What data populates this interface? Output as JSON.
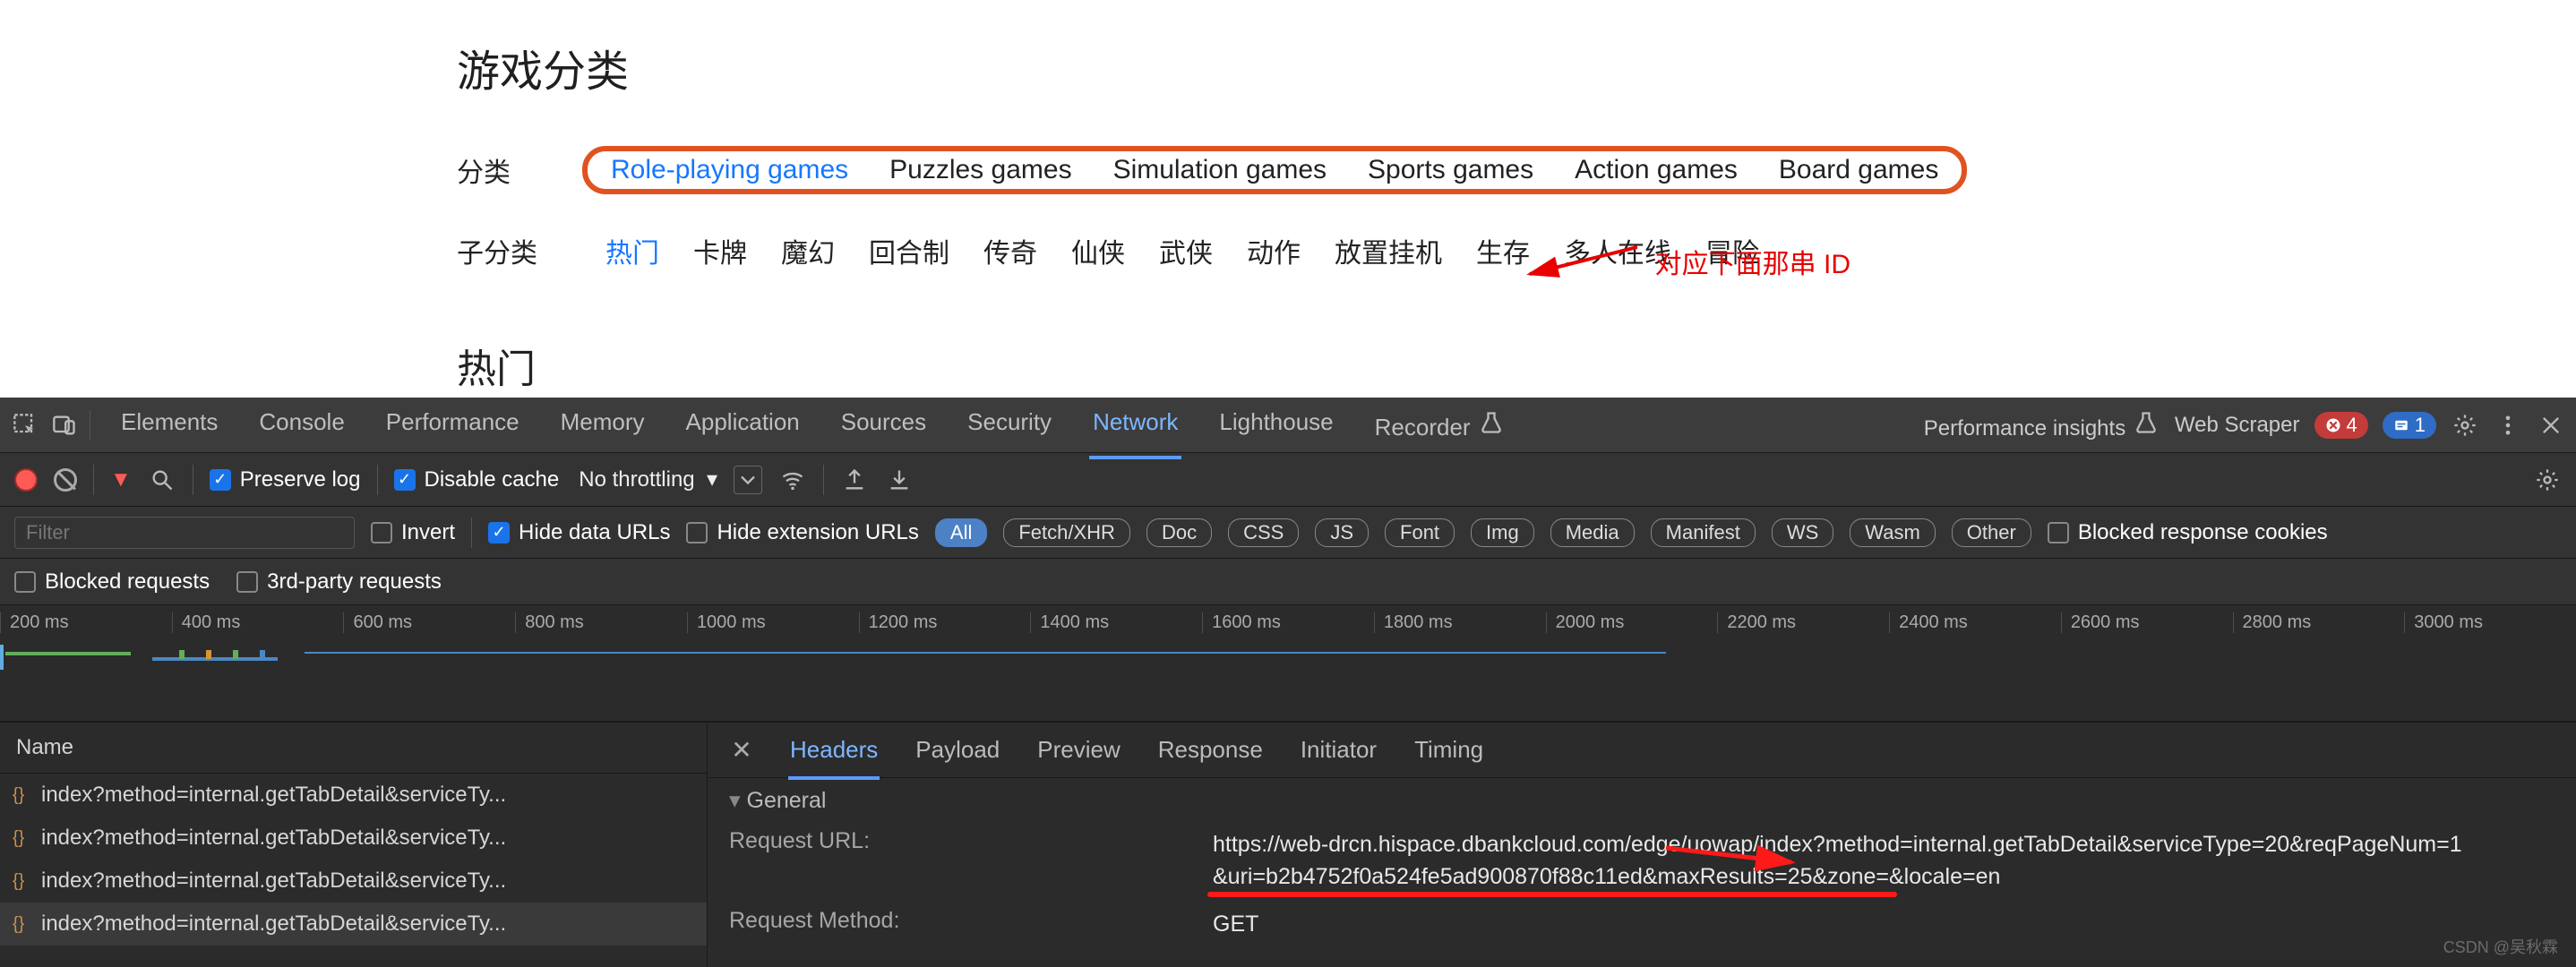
{
  "page": {
    "title": "游戏分类",
    "category_label": "分类",
    "subcategory_label": "子分类",
    "categories": [
      "Role-playing games",
      "Puzzles games",
      "Simulation games",
      "Sports games",
      "Action games",
      "Board games"
    ],
    "subcategories": [
      "热门",
      "卡牌",
      "魔幻",
      "回合制",
      "传奇",
      "仙侠",
      "武侠",
      "动作",
      "放置挂机",
      "生存",
      "多人在线",
      "冒险"
    ],
    "section_title": "热门",
    "annotation_text": "对应下面那串 ID"
  },
  "devtools": {
    "tabs": [
      "Elements",
      "Console",
      "Performance",
      "Memory",
      "Application",
      "Sources",
      "Security",
      "Network",
      "Lighthouse",
      "Recorder"
    ],
    "active_tab": "Network",
    "right_tabs": [
      "Performance insights",
      "Web Scraper"
    ],
    "error_count": "4",
    "info_count": "1",
    "subbar": {
      "preserve_log": "Preserve log",
      "disable_cache": "Disable cache",
      "throttling": "No throttling"
    },
    "filterbar": {
      "filter_placeholder": "Filter",
      "invert": "Invert",
      "hide_data_urls": "Hide data URLs",
      "hide_ext_urls": "Hide extension URLs",
      "types": [
        "All",
        "Fetch/XHR",
        "Doc",
        "CSS",
        "JS",
        "Font",
        "Img",
        "Media",
        "Manifest",
        "WS",
        "Wasm",
        "Other"
      ],
      "blocked_cookies": "Blocked response cookies",
      "blocked_requests": "Blocked requests",
      "third_party": "3rd-party requests"
    },
    "timeline_ticks": [
      "200 ms",
      "400 ms",
      "600 ms",
      "800 ms",
      "1000 ms",
      "1200 ms",
      "1400 ms",
      "1600 ms",
      "1800 ms",
      "2000 ms",
      "2200 ms",
      "2400 ms",
      "2600 ms",
      "2800 ms",
      "3000 ms"
    ],
    "reqlist_header": "Name",
    "requests": [
      "index?method=internal.getTabDetail&serviceTy...",
      "index?method=internal.getTabDetail&serviceTy...",
      "index?method=internal.getTabDetail&serviceTy...",
      "index?method=internal.getTabDetail&serviceTy..."
    ],
    "detail_tabs": [
      "Headers",
      "Payload",
      "Preview",
      "Response",
      "Initiator",
      "Timing"
    ],
    "detail_active": "Headers",
    "general_label": "General",
    "kv": {
      "request_url_label": "Request URL:",
      "request_url_value_line1": "https://web-drcn.hispace.dbankcloud.com/edge/uowap/index?method=internal.getTabDetail&serviceType=20&reqPageNum=1",
      "request_url_value_line2": "&uri=b2b4752f0a524fe5ad900870f88c11ed&maxResults=25&zone=&locale=en",
      "request_method_label": "Request Method:",
      "request_method_value": "GET"
    },
    "watermark": "CSDN @吴秋霖"
  }
}
